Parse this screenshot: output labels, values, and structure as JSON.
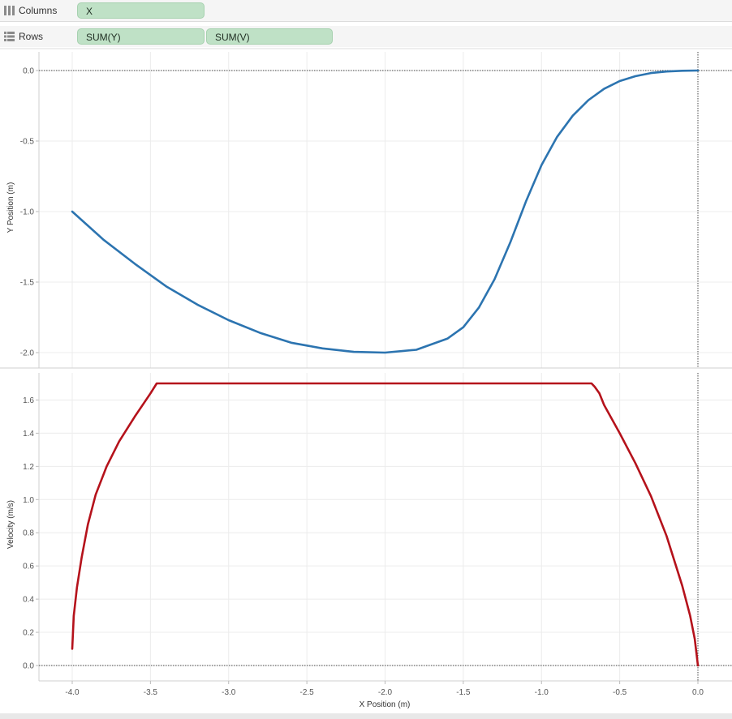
{
  "shelves": {
    "columns": {
      "label": "Columns",
      "icon": "columns-icon",
      "pills": [
        "X"
      ]
    },
    "rows": {
      "label": "Rows",
      "icon": "rows-icon",
      "pills": [
        "SUM(Y)",
        "SUM(V)"
      ]
    }
  },
  "colors": {
    "series_y": "#2c74b0",
    "series_v": "#b5121b",
    "pill": "#bfe1c6"
  },
  "chart_data": [
    {
      "type": "line",
      "ylabel": "Y Position (m)",
      "ylim": [
        -2.0,
        0.0
      ],
      "yticks": [
        "0.0",
        "-0.5",
        "-1.0",
        "-1.5",
        "-2.0"
      ],
      "xlim": [
        -4.2,
        0.2
      ],
      "grid": true,
      "series": [
        {
          "x": [
            -4.0,
            -3.8,
            -3.6,
            -3.4,
            -3.2,
            -3.0,
            -2.8,
            -2.6,
            -2.4,
            -2.2,
            -2.0,
            -1.8,
            -1.6,
            -1.5,
            -1.4,
            -1.3,
            -1.2,
            -1.1,
            -1.0,
            -0.9,
            -0.8,
            -0.7,
            -0.6,
            -0.5,
            -0.4,
            -0.3,
            -0.2,
            -0.1,
            0.0
          ],
          "values": [
            -1.0,
            -1.2,
            -1.37,
            -1.53,
            -1.66,
            -1.77,
            -1.86,
            -1.93,
            -1.97,
            -1.995,
            -2.0,
            -1.98,
            -1.9,
            -1.82,
            -1.68,
            -1.48,
            -1.22,
            -0.93,
            -0.67,
            -0.47,
            -0.32,
            -0.21,
            -0.13,
            -0.075,
            -0.04,
            -0.018,
            -0.007,
            -0.002,
            0.0
          ]
        }
      ]
    },
    {
      "type": "line",
      "ylabel": "Velocity (m/s)",
      "xlabel": "X Position (m)",
      "ylim": [
        0.0,
        1.7
      ],
      "yticks": [
        "1.6",
        "1.4",
        "1.2",
        "1.0",
        "0.8",
        "0.6",
        "0.4",
        "0.2",
        "0.0"
      ],
      "xticks": [
        "-4.0",
        "-3.5",
        "-3.0",
        "-2.5",
        "-2.0",
        "-1.5",
        "-1.0",
        "-0.5",
        "0.0"
      ],
      "xlim": [
        -4.2,
        0.2
      ],
      "grid": true,
      "series": [
        {
          "x": [
            -4.0,
            -3.99,
            -3.97,
            -3.94,
            -3.9,
            -3.85,
            -3.78,
            -3.7,
            -3.6,
            -3.5,
            -3.46,
            -3.0,
            -2.0,
            -1.0,
            -0.68,
            -0.66,
            -0.63,
            -0.6,
            -0.5,
            -0.4,
            -0.3,
            -0.2,
            -0.1,
            -0.05,
            -0.02,
            0.0
          ],
          "values": [
            0.1,
            0.3,
            0.47,
            0.65,
            0.85,
            1.03,
            1.2,
            1.35,
            1.5,
            1.64,
            1.7,
            1.7,
            1.7,
            1.7,
            1.7,
            1.68,
            1.64,
            1.57,
            1.4,
            1.22,
            1.02,
            0.78,
            0.48,
            0.3,
            0.16,
            0.0
          ]
        }
      ]
    }
  ]
}
